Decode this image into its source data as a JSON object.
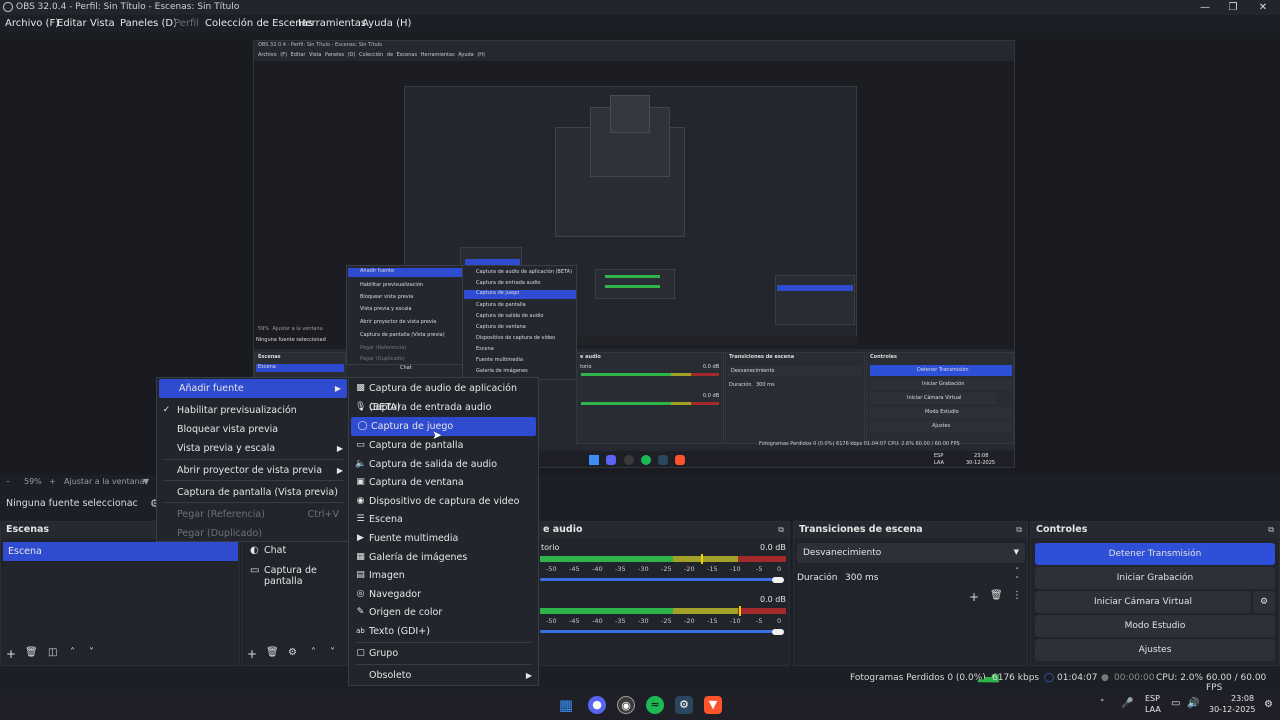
{
  "window": {
    "title": "OBS 32.0.4 - Perfil: Sin Título - Escenas: Sin Título"
  },
  "menu": {
    "items": [
      "Archivo (F)",
      "Editar",
      "Vista",
      "Paneles (D)",
      "Perfil",
      "Colección de Escenas",
      "Herramientas",
      "Ayuda (H)"
    ]
  },
  "nested": {
    "title": "OBS 32.0.4 - Perfil: Sin Título - Escenas: Sin Título",
    "menu": "Archivo (F)  Editar  Vista  Paneles (D)  Colección de Escenas  Herramientas  Ayuda (H)",
    "no_source": "Ninguna fuente seleccionad",
    "scenes_title": "Escenas",
    "scene": "Escena",
    "chat": "Chat",
    "audio_title": "e audio",
    "transitions_title": "Transiciones de escena",
    "controls_title": "Controles",
    "fade": "Desvanecimiento",
    "duration_label": "Duración",
    "duration_value": "300 ms",
    "stop_stream": "Detener Transmisión",
    "start_rec": "Iniciar Grabación",
    "start_cam": "Iniciar Cámara Virtual",
    "studio": "Modo Estudio",
    "settings": "Ajustes",
    "zoom": "59%",
    "fit": "Ajustar a la ventana",
    "ctx_main": [
      "Añadir fuente",
      "Habilitar previsualización",
      "Bloquear vista previa",
      "Vista previa y escala",
      "Abrir proyector de vista previa",
      "Captura de pantalla (Vista previa)",
      "Pegar (Referencia)",
      "Pegar (Duplicado)"
    ],
    "ctx_sub": [
      "Captura de audio de aplicación (BETA)",
      "Captura de entrada audio",
      "Captura de juego",
      "Captura de pantalla",
      "Captura de salida de audio",
      "Captura de ventana",
      "Dispositivo de captura de vídeo",
      "Escena",
      "Fuente multimedia",
      "Galería de imágenes"
    ],
    "ctrl_v": "Ctrl+V",
    "status": "Fotogramas Perdidos 0 (0.0%)   6176 kbps   01:04:07   CPU: 2.6%   60.00 / 60.00 FPS",
    "zero_db": "0.0 dB",
    "audio_src": "torio",
    "lang": "ESP",
    "lang2": "LAA",
    "time": "23:08",
    "date": "30-12-2025"
  },
  "preview_bar": {
    "zoom": "59%",
    "fit": "Ajustar a la ventana"
  },
  "source_toolbar": {
    "no_source": "Ninguna fuente seleccionac"
  },
  "scenes": {
    "title": "Escenas",
    "items": [
      "Escena"
    ]
  },
  "sources": {
    "items": [
      "Chat",
      "Captura de pantalla"
    ]
  },
  "audio": {
    "title": "e audio",
    "tracks": [
      {
        "name": "torio",
        "db": "0.0 dB"
      },
      {
        "name": "",
        "db": "0.0 dB"
      }
    ],
    "scale": [
      "-50",
      "-45",
      "-40",
      "-35",
      "-30",
      "-25",
      "-20",
      "-15",
      "-10",
      "-5",
      "0"
    ]
  },
  "transitions": {
    "title": "Transiciones de escena",
    "selected": "Desvanecimiento",
    "duration_label": "Duración",
    "duration_value": "300 ms"
  },
  "controls": {
    "title": "Controles",
    "stop_stream": "Detener Transmisión",
    "start_recording": "Iniciar Grabación",
    "start_virtual_cam": "Iniciar Cámara Virtual",
    "studio_mode": "Modo Estudio",
    "settings": "Ajustes"
  },
  "context_menu": {
    "items": [
      {
        "label": "Añadir fuente",
        "submenu": true,
        "highlight": true
      },
      {
        "label": "Habilitar previsualización",
        "checked": true
      },
      {
        "label": "Bloquear vista previa"
      },
      {
        "label": "Vista previa y escala",
        "submenu": true
      },
      {
        "label": "Abrir proyector de vista previa",
        "submenu": true
      },
      {
        "label": "Captura de pantalla (Vista previa)"
      },
      {
        "label": "Pegar (Referencia)",
        "shortcut": "Ctrl+V",
        "disabled": true
      },
      {
        "label": "Pegar (Duplicado)",
        "disabled": true
      }
    ]
  },
  "add_source_menu": {
    "items": [
      {
        "label": "Captura de audio de aplicación (BETA)",
        "icon": "app-audio-icon"
      },
      {
        "label": "Captura de entrada audio",
        "icon": "microphone-icon"
      },
      {
        "label": "Captura de juego",
        "icon": "gamepad-icon",
        "highlight": true
      },
      {
        "label": "Captura de pantalla",
        "icon": "monitor-icon"
      },
      {
        "label": "Captura de salida de audio",
        "icon": "speaker-icon"
      },
      {
        "label": "Captura de ventana",
        "icon": "window-icon"
      },
      {
        "label": "Dispositivo de captura de video",
        "icon": "camera-icon"
      },
      {
        "label": "Escena",
        "icon": "list-icon"
      },
      {
        "label": "Fuente multimedia",
        "icon": "play-icon"
      },
      {
        "label": "Galería de imágenes",
        "icon": "gallery-icon"
      },
      {
        "label": "Imagen",
        "icon": "image-icon"
      },
      {
        "label": "Navegador",
        "icon": "globe-icon"
      },
      {
        "label": "Origen de color",
        "icon": "brush-icon"
      },
      {
        "label": "Texto (GDI+)",
        "icon": "text-icon"
      },
      {
        "label": "Grupo",
        "icon": "folder-icon"
      },
      {
        "label": "Obsoleto",
        "submenu": true
      }
    ]
  },
  "status": {
    "dropped": "Fotogramas Perdidos 0 (0.0%)",
    "bitrate": "6176 kbps",
    "stream_time": "01:04:07",
    "rec_time": "00:00:00",
    "cpu": "CPU: 2.0%",
    "fps": "60.00 / 60.00 FPS"
  },
  "taskbar": {
    "lang": "ESP",
    "lang_sub": "LAA",
    "time": "23:08",
    "date": "30-12-2025"
  },
  "colors": {
    "accent": "#2f4bd0",
    "panel": "#22242b",
    "background": "#1d1f26"
  }
}
